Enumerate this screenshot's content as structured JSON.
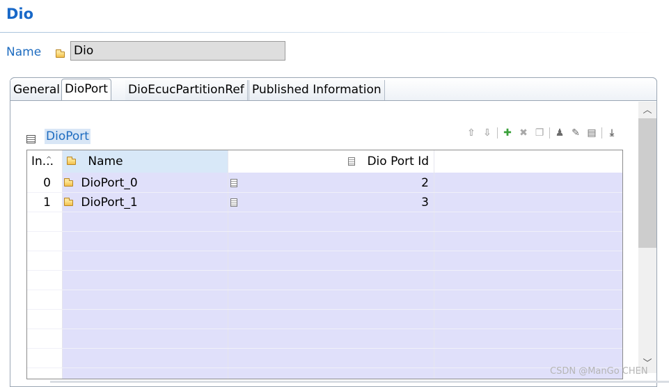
{
  "editor": {
    "title": "Dio",
    "name_label": "Name",
    "name_value": "Dio"
  },
  "tabs": [
    {
      "label": "General",
      "active": false
    },
    {
      "label": "DioPort",
      "active": true
    },
    {
      "label": "DioEcucPartitionRef",
      "active": false
    },
    {
      "label": "Published Information",
      "active": false
    }
  ],
  "section": {
    "title": "DioPort",
    "toolbar": [
      "move-up-icon",
      "move-down-icon",
      "add-icon",
      "delete-icon",
      "copy-icon",
      "user-icon",
      "edit-icon",
      "properties-icon",
      "import-icon"
    ]
  },
  "table": {
    "columns": [
      "In...",
      "Name",
      "Dio Port Id"
    ],
    "rows": [
      {
        "index": "0",
        "name": "DioPort_0",
        "port_id": "2"
      },
      {
        "index": "1",
        "name": "DioPort_1",
        "port_id": "3"
      }
    ]
  },
  "watermark": "CSDN @ManGo CHEN",
  "colors": {
    "accent": "#1868c8",
    "table_cell_bg": "#e0e0fa",
    "header_selected_bg": "#d8e8f8"
  }
}
